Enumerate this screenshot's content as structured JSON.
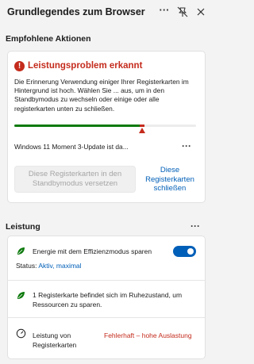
{
  "header": {
    "title": "Grundlegendes zum Browser",
    "more_label": "···"
  },
  "recommended": {
    "section_title": "Empfohlene Aktionen",
    "alert_title": "Leistungsproblem erkannt",
    "alert_body": "Die Erinnerung Verwendung einiger Ihrer Registerkarten im Hintergrund ist hoch. Wählen Sie ... aus, um in den Standbymodus zu wechseln oder einige oder alle registerkarten unten zu schließen.",
    "meter_fraction": 0.69,
    "update_row": "Windows 11 Moment 3-Update ist da...",
    "update_more": "···",
    "sleep_button": "Diese Registerkarten in den Standbymodus versetzen",
    "close_tabs_link": "Diese Registerkarten schließen",
    "colors": {
      "alert": "#c42b1c",
      "good": "#0e7a0d",
      "link": "#005fb8"
    }
  },
  "performance": {
    "section_title": "Leistung",
    "more_label": "···",
    "efficiency_label": "Energie mit dem Effizienzmodus sparen",
    "efficiency_toggle_on": true,
    "status_prefix": "Status:",
    "status_value": "Aktiv, maximal",
    "sleeping_label": "1 Registerkarte befindet sich im Ruhezustand, um Ressourcen zu sparen.",
    "perf_label": "Leistung von Registerkarten",
    "perf_value": "Fehlerhaft – hohe Auslastung"
  }
}
